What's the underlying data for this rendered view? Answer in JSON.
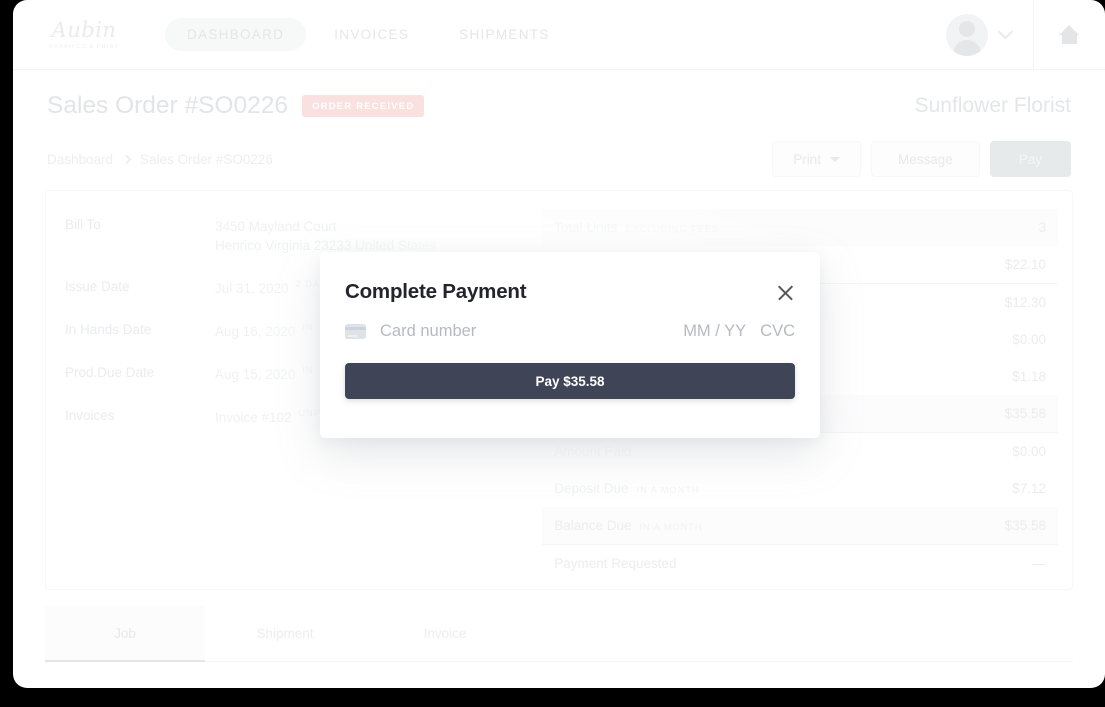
{
  "nav": {
    "logo_name": "Aubin",
    "logo_tagline": "GRAPHICS & PRINT",
    "links": [
      {
        "label": "DASHBOARD",
        "active": true
      },
      {
        "label": "INVOICES",
        "active": false
      },
      {
        "label": "SHIPMENTS",
        "active": false
      }
    ],
    "avatar_icon": "user-avatar-icon",
    "chevron_icon": "chevron-down-icon",
    "home_icon": "home-icon"
  },
  "header": {
    "title": "Sales Order #SO0226",
    "status_badge": "ORDER RECEIVED",
    "badge_bg": "#fbe0e0",
    "customer": "Sunflower Florist"
  },
  "breadcrumb": {
    "items": [
      "Dashboard",
      "Sales Order #SO0226"
    ]
  },
  "actions": {
    "print_label": "Print",
    "message_label": "Message",
    "pay_label": "Pay"
  },
  "details": [
    {
      "label": "Bill To",
      "value": "3450 Mayland Court",
      "value2": "Henrico Virginia 23233 United States",
      "caption": ""
    },
    {
      "label": "Issue Date",
      "value": "Jul 31, 2020",
      "caption": "2 DA"
    },
    {
      "label": "In Hands Date",
      "value": "Aug 16, 2020",
      "caption": "IN"
    },
    {
      "label": "Prod.Due Date",
      "value": "Aug 15, 2020",
      "caption": "IN"
    },
    {
      "label": "Invoices",
      "value": "Invoice #102",
      "caption": "UNP"
    }
  ],
  "summary": [
    {
      "label": "Total Units",
      "caption": "EXCLUDING FEES",
      "value": "3",
      "shade": true,
      "sep": false
    },
    {
      "label": "",
      "caption": "",
      "value": "$22.10",
      "shade": false,
      "sep": true
    },
    {
      "label": "",
      "caption": "",
      "value": "$12.30",
      "shade": false,
      "sep": false
    },
    {
      "label": "",
      "caption": "",
      "value": "$0.00",
      "shade": false,
      "sep": false
    },
    {
      "label": "",
      "caption": "",
      "value": "$1.18",
      "shade": false,
      "sep": false
    },
    {
      "label": "",
      "caption": "",
      "value": "$35.58",
      "shade": true,
      "sep": true
    },
    {
      "label": "Amount Paid",
      "caption": "",
      "value": "$0.00",
      "shade": false,
      "sep": false
    },
    {
      "label": "Deposit Due",
      "caption": "IN A MONTH",
      "value": "$7.12",
      "shade": false,
      "sep": false
    },
    {
      "label": "Balance Due",
      "caption": "IN A MONTH",
      "value": "$35.58",
      "shade": true,
      "sep": true
    },
    {
      "label": "Payment Requested",
      "caption": "",
      "value": "—",
      "shade": false,
      "sep": false
    }
  ],
  "tabs": [
    {
      "label": "Job",
      "active": true
    },
    {
      "label": "Shipment",
      "active": false
    },
    {
      "label": "Invoice",
      "active": false
    }
  ],
  "modal": {
    "title": "Complete Payment",
    "close_icon": "close-icon",
    "card_icon": "credit-card-icon",
    "card_placeholder": "Card number",
    "expiry_placeholder": "MM / YY",
    "cvc_placeholder": "CVC",
    "pay_button": "Pay $35.58",
    "pay_button_color": "#3f4457"
  }
}
